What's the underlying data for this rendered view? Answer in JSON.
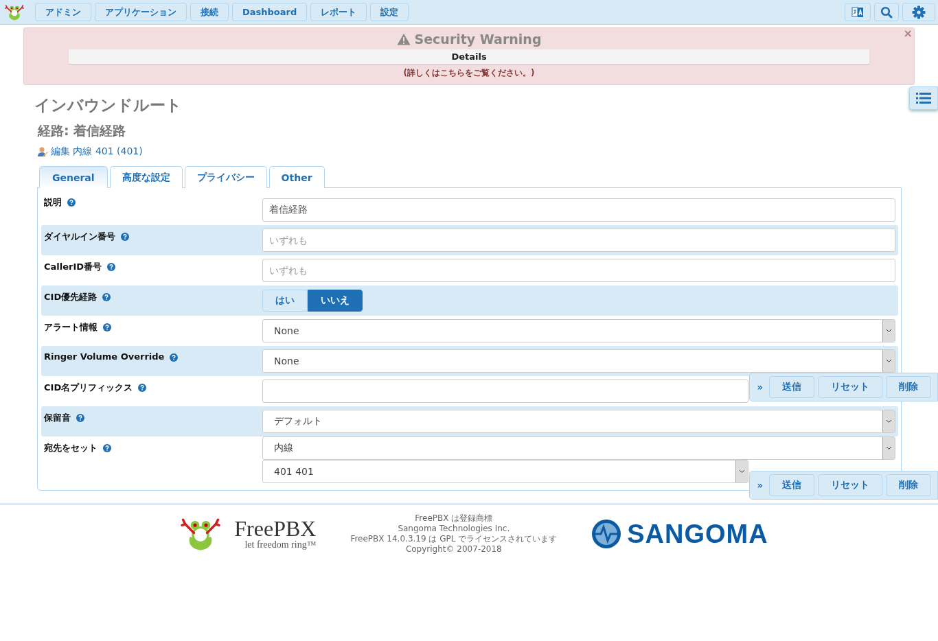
{
  "navbar": {
    "menu": [
      {
        "label": "アドミン"
      },
      {
        "label": "アプリケーション"
      },
      {
        "label": "接続"
      },
      {
        "label": "Dashboard"
      },
      {
        "label": "レポート"
      },
      {
        "label": "設定"
      }
    ]
  },
  "alert": {
    "title": "Security Warning",
    "details": "Details",
    "message": "(詳しくはこちらをご覧ください。)",
    "close": "×"
  },
  "page": {
    "title": "インバウンドルート",
    "subtitle": "経路: 着信経路",
    "edit_link": "編集 内線 401 (401)"
  },
  "tabs": [
    {
      "label": "General",
      "selected": true
    },
    {
      "label": "高度な設定",
      "selected": false
    },
    {
      "label": "プライバシー",
      "selected": false
    },
    {
      "label": "Other",
      "selected": false
    }
  ],
  "form_rows": [
    {
      "kind": "text",
      "label": "説明",
      "value": "着信経路"
    },
    {
      "kind": "text",
      "label": "ダイヤルイン番号",
      "placeholder": "いずれも"
    },
    {
      "kind": "text",
      "label": "CallerID番号",
      "placeholder": "いずれも"
    },
    {
      "kind": "toggle",
      "label": "CID優先経路",
      "options": [
        {
          "label": "はい",
          "selected": false
        },
        {
          "label": "いいえ",
          "selected": true
        }
      ]
    },
    {
      "kind": "select",
      "label": "アラート情報",
      "value": "None"
    },
    {
      "kind": "select",
      "label": "Ringer Volume Override",
      "value": "None"
    },
    {
      "kind": "text",
      "label": "CID名プリフィックス"
    },
    {
      "kind": "select",
      "label": "保留音",
      "value": "デフォルト"
    },
    {
      "kind": "destination",
      "label": "宛先をセット",
      "value": "内線",
      "sub_value": "401 401"
    }
  ],
  "action_bars": [
    {
      "expand": "»",
      "buttons": [
        "送信",
        "リセット",
        "削除"
      ]
    },
    {
      "expand": "»",
      "buttons": [
        "送信",
        "リセット",
        "削除"
      ]
    }
  ],
  "footer": {
    "freepbx_name": "FreePBX",
    "freepbx_tagline": "let freedom ring™",
    "legal": [
      "FreePBX は登録商標",
      "Sangoma Technologies Inc.",
      "FreePBX 14.0.3.19 は GPL でライセンスされています",
      "Copyright© 2007-2018"
    ],
    "sangoma_name": "SANGOMA"
  }
}
